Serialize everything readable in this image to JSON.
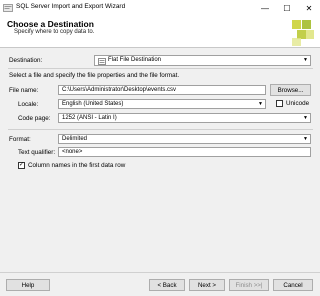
{
  "window": {
    "title": "SQL Server Import and Export Wizard",
    "minimize": "—",
    "maximize": "☐",
    "close": "✕"
  },
  "header": {
    "title": "Choose a Destination",
    "subtitle": "Specify where to copy data to."
  },
  "form": {
    "destination_label": "Destination:",
    "destination_value": "Flat File Destination",
    "instructions": "Select a file and specify the file properties and the file format.",
    "file_name_label": "File name:",
    "file_name_value": "C:\\Users\\Administrator\\Desktop\\events.csv",
    "browse_label": "Browse...",
    "locale_label": "Locale:",
    "locale_value": "English (United States)",
    "unicode_label": "Unicode",
    "code_page_label": "Code page:",
    "code_page_value": "1252  (ANSI - Latin I)",
    "format_label": "Format:",
    "format_value": "Delimited",
    "text_qualifier_label": "Text qualifier:",
    "text_qualifier_value": "<none>",
    "column_names_label": "Column names in the first data row"
  },
  "footer": {
    "help": "Help",
    "back": "< Back",
    "next": "Next >",
    "finish": "Finish >>|",
    "cancel": "Cancel"
  }
}
